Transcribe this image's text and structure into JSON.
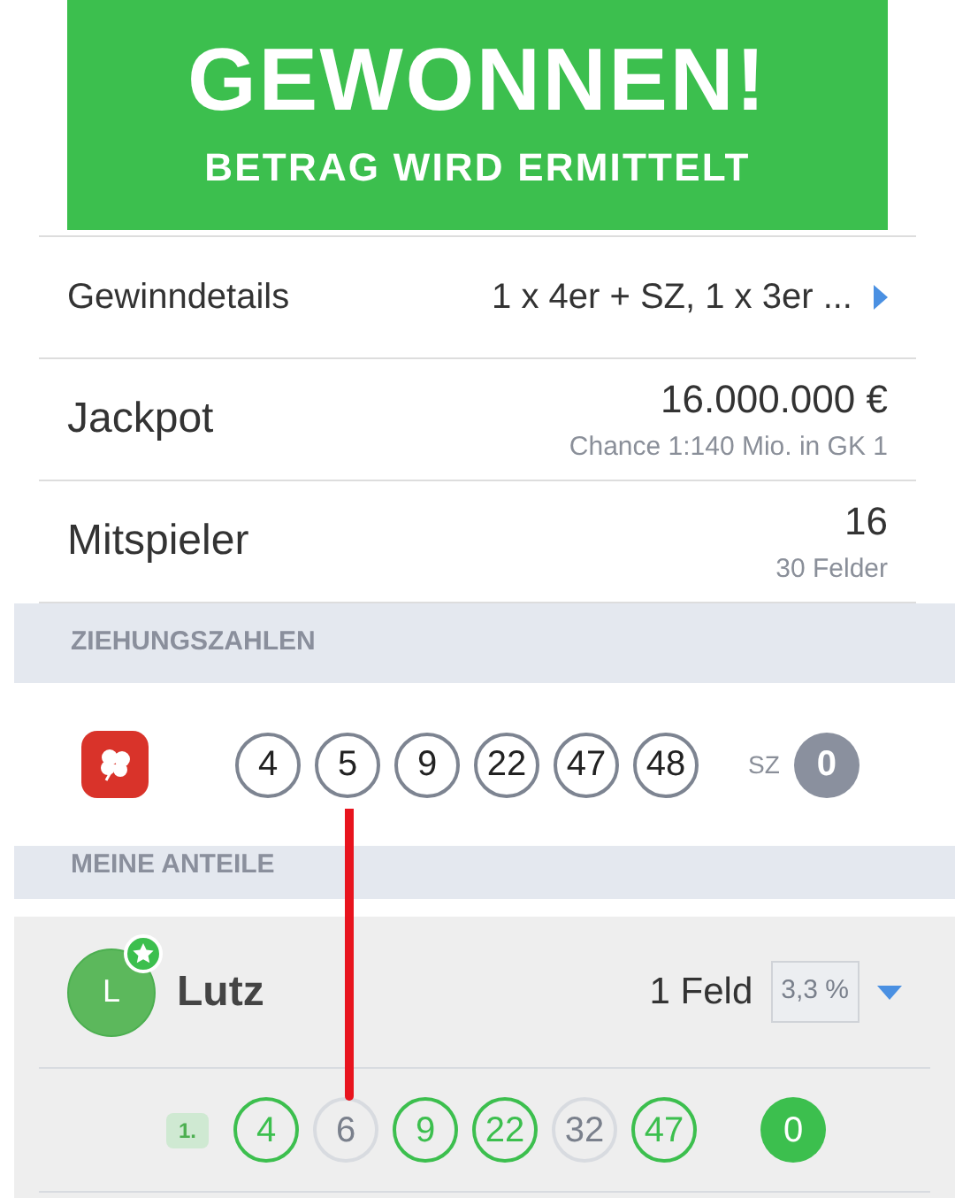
{
  "banner": {
    "title": "GEWONNEN!",
    "subtitle": "BETRAG WIRD ERMITTELT"
  },
  "details": [
    {
      "label": "Gewinndetails",
      "value": "1 x 4er + SZ, 1 x 3er ...",
      "link": true
    },
    {
      "label": "Jackpot",
      "value": "16.000.000 €",
      "note": "Chance 1:140 Mio. in GK 1",
      "link": false
    },
    {
      "label": "Mitspieler",
      "value": "16",
      "note": "30 Felder",
      "link": false
    }
  ],
  "draw": {
    "header": "ZIEHUNGSZAHLEN",
    "numbers": [
      "4",
      "5",
      "9",
      "22",
      "47",
      "48"
    ],
    "super_label": "SZ",
    "super_number": "0"
  },
  "shares": {
    "header": "MEINE ANTEILE",
    "player": {
      "initial": "L",
      "name": "Lutz",
      "favorite": true,
      "fields": "1 Feld",
      "percent": "3,3 %"
    },
    "rows": [
      {
        "index": "1.",
        "super_number": "0",
        "super_matched": true,
        "numbers": [
          {
            "value": "4",
            "matched": true
          },
          {
            "value": "6",
            "matched": false
          },
          {
            "value": "9",
            "matched": true
          },
          {
            "value": "22",
            "matched": true
          },
          {
            "value": "32",
            "matched": false
          },
          {
            "value": "47",
            "matched": true
          }
        ]
      }
    ]
  }
}
